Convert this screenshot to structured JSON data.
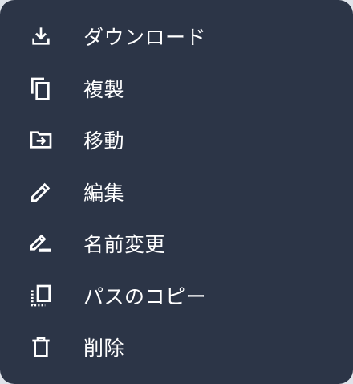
{
  "menu": {
    "items": [
      {
        "label": "ダウンロード",
        "icon": "download-icon"
      },
      {
        "label": "複製",
        "icon": "duplicate-icon"
      },
      {
        "label": "移動",
        "icon": "move-to-folder-icon"
      },
      {
        "label": "編集",
        "icon": "edit-pencil-icon"
      },
      {
        "label": "名前変更",
        "icon": "rename-icon"
      },
      {
        "label": "パスのコピー",
        "icon": "copy-path-icon"
      },
      {
        "label": "削除",
        "icon": "trash-icon"
      }
    ]
  },
  "colors": {
    "menu_background": "#2c3547",
    "text": "#ffffff"
  }
}
